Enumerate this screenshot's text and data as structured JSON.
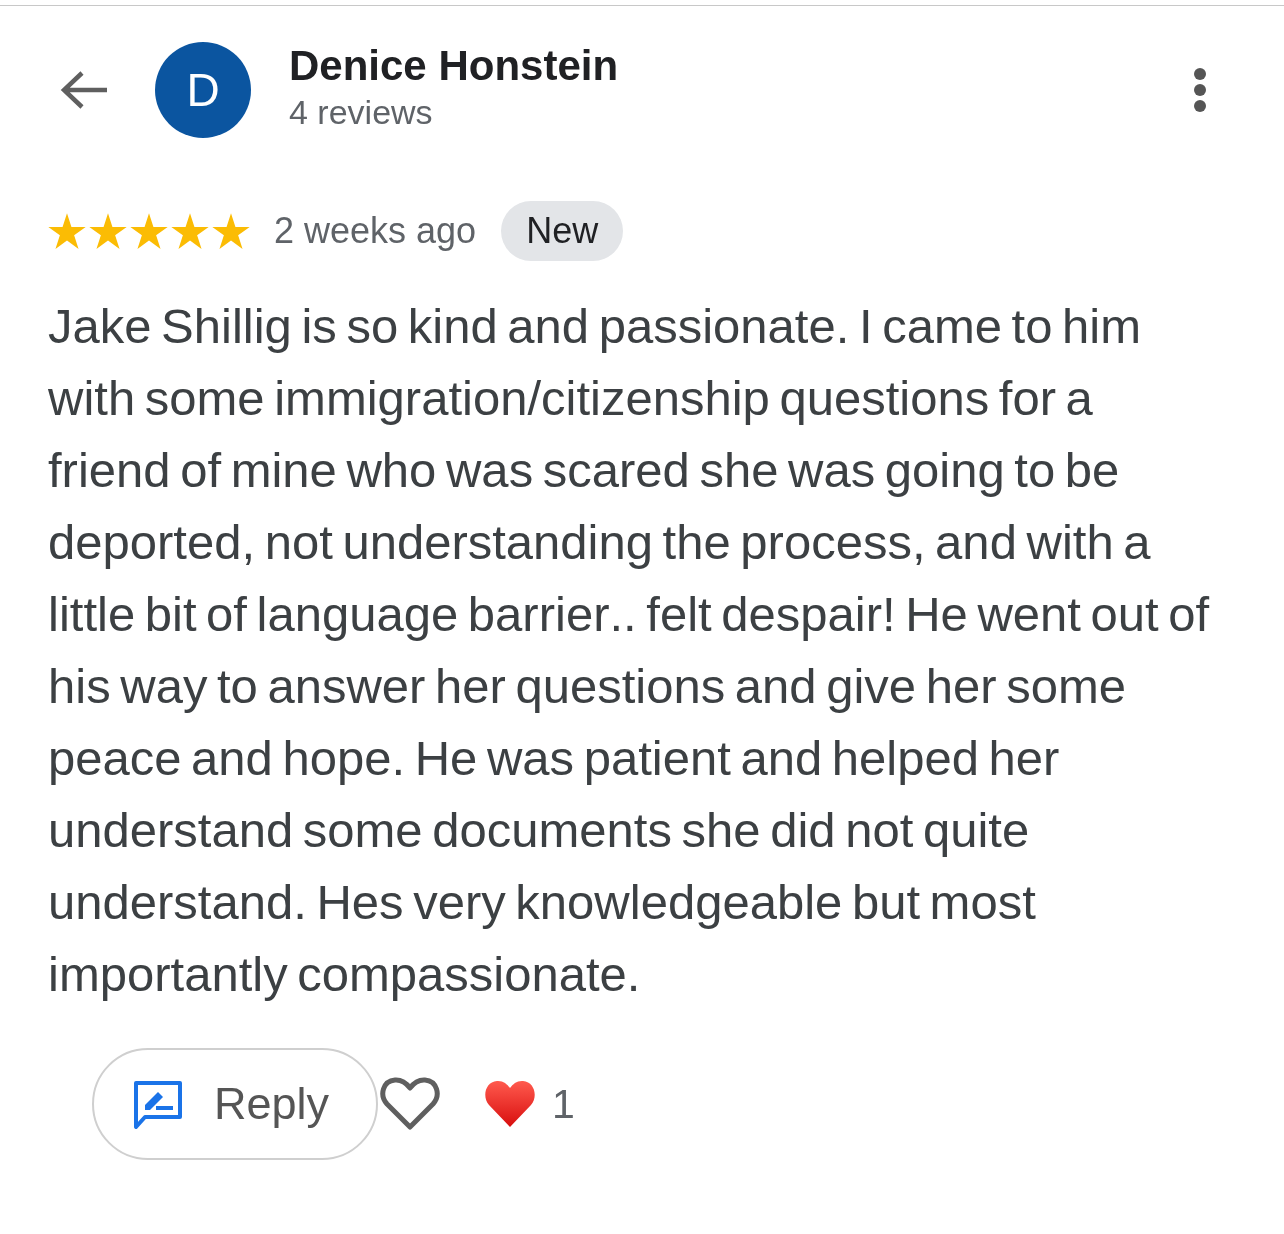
{
  "reviewer": {
    "avatar_letter": "D",
    "name": "Denice Honstein",
    "review_count": "4 reviews"
  },
  "review": {
    "stars": 5,
    "time": "2 weeks ago",
    "badge": "New",
    "text": "Jake Shillig is so kind and passionate. I came to him with some immigration/citizenship questions for a friend of mine who was scared she was going to be deported, not understanding the process, and with a little bit of language barrier.. felt despair! He went out of his way to answer her questions and give her some peace and hope. He was patient and helped her understand some documents she did not quite understand. Hes very knowledgeable but most importantly compassionate."
  },
  "actions": {
    "reply_label": "Reply",
    "like_button": {
      "selected": false
    },
    "reactions": [
      {
        "count": "1"
      }
    ]
  }
}
